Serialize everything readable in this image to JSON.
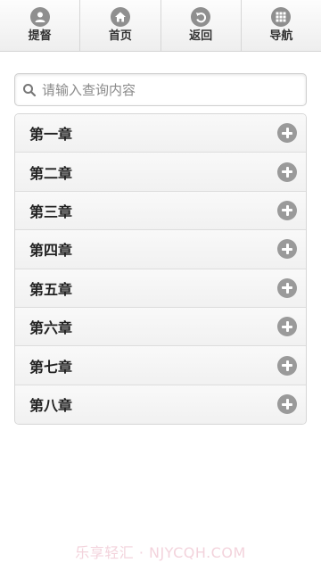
{
  "nav": {
    "items": [
      {
        "label": "提督",
        "icon": "user-icon"
      },
      {
        "label": "首页",
        "icon": "home-icon"
      },
      {
        "label": "返回",
        "icon": "back-icon"
      },
      {
        "label": "导航",
        "icon": "grid-icon"
      }
    ]
  },
  "search": {
    "placeholder": "请输入查询内容",
    "value": ""
  },
  "chapters": [
    {
      "label": "第一章"
    },
    {
      "label": "第二章"
    },
    {
      "label": "第三章"
    },
    {
      "label": "第四章"
    },
    {
      "label": "第五章"
    },
    {
      "label": "第六章"
    },
    {
      "label": "第七章"
    },
    {
      "label": "第八章"
    }
  ],
  "watermark": "乐享轻汇 · NJYCQH.COM",
  "colors": {
    "icon_gray": "#8f8f8f",
    "plus_gray": "#9a9a9a",
    "watermark": "#f3d3dc"
  }
}
